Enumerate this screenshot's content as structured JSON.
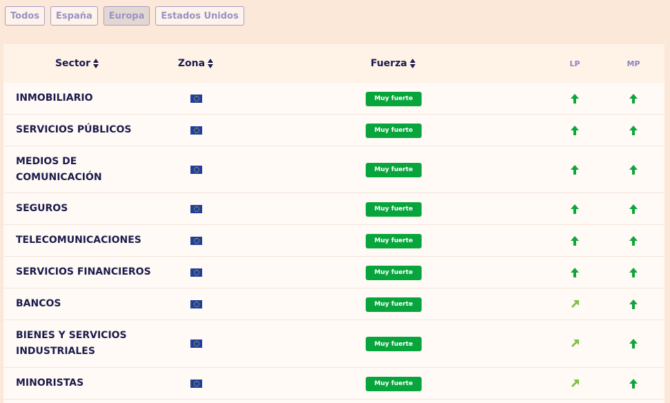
{
  "filters": [
    {
      "label": "Todos",
      "active": false
    },
    {
      "label": "España",
      "active": false
    },
    {
      "label": "Europa",
      "active": true
    },
    {
      "label": "Estados Unidos",
      "active": false
    }
  ],
  "table": {
    "headers": {
      "sector": "Sector",
      "zona": "Zona",
      "fuerza": "Fuerza",
      "lp": "LP",
      "mp": "MP"
    },
    "rows": [
      {
        "sector": "INMOBILIARIO",
        "zona": "eu-flag-icon",
        "fuerza": "Muy fuerte",
        "lp": "arrow-up-icon",
        "mp": "arrow-up-icon"
      },
      {
        "sector": "SERVICIOS PÚBLICOS",
        "zona": "eu-flag-icon",
        "fuerza": "Muy fuerte",
        "lp": "arrow-up-icon",
        "mp": "arrow-up-icon"
      },
      {
        "sector": "MEDIOS DE COMUNICACIÓN",
        "zona": "eu-flag-icon",
        "fuerza": "Muy fuerte",
        "lp": "arrow-up-icon",
        "mp": "arrow-up-icon"
      },
      {
        "sector": "SEGUROS",
        "zona": "eu-flag-icon",
        "fuerza": "Muy fuerte",
        "lp": "arrow-up-icon",
        "mp": "arrow-up-icon"
      },
      {
        "sector": "TELECOMUNICACIONES",
        "zona": "eu-flag-icon",
        "fuerza": "Muy fuerte",
        "lp": "arrow-up-icon",
        "mp": "arrow-up-icon"
      },
      {
        "sector": "SERVICIOS FINANCIEROS",
        "zona": "eu-flag-icon",
        "fuerza": "Muy fuerte",
        "lp": "arrow-up-icon",
        "mp": "arrow-up-icon"
      },
      {
        "sector": "BANCOS",
        "zona": "eu-flag-icon",
        "fuerza": "Muy fuerte",
        "lp": "arrow-up-right-icon",
        "mp": "arrow-up-icon"
      },
      {
        "sector": "BIENES Y SERVICIOS INDUSTRIALES",
        "zona": "eu-flag-icon",
        "fuerza": "Muy fuerte",
        "lp": "arrow-up-right-icon",
        "mp": "arrow-up-icon"
      },
      {
        "sector": "MINORISTAS",
        "zona": "eu-flag-icon",
        "fuerza": "Muy fuerte",
        "lp": "arrow-up-right-icon",
        "mp": "arrow-up-icon"
      }
    ]
  },
  "colors": {
    "background": "#fbe8d8",
    "badge_green": "#07a53c",
    "arrow_up_green": "#0ea63a",
    "arrow_diag_green": "#7cc242",
    "text_navy": "#1b1b4b"
  }
}
